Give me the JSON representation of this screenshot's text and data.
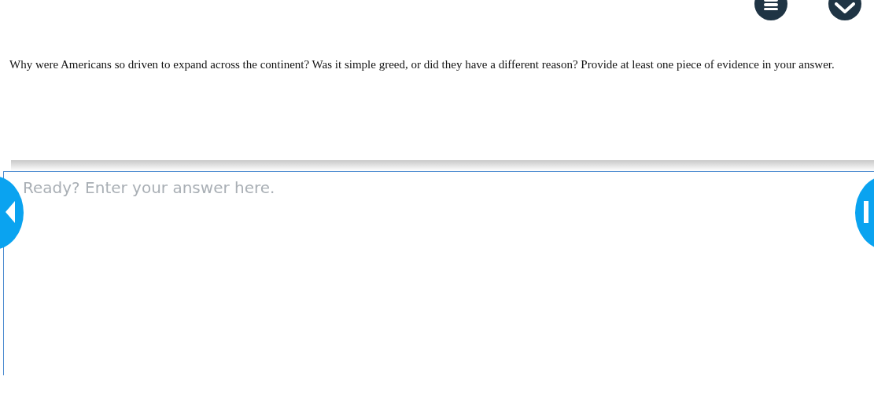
{
  "question": "Why were Americans so driven to expand across the continent? Was it simple greed, or did they have a different reason? Provide at least one piece of evidence in your answer.",
  "answer": {
    "placeholder": "Ready? Enter your answer here."
  }
}
